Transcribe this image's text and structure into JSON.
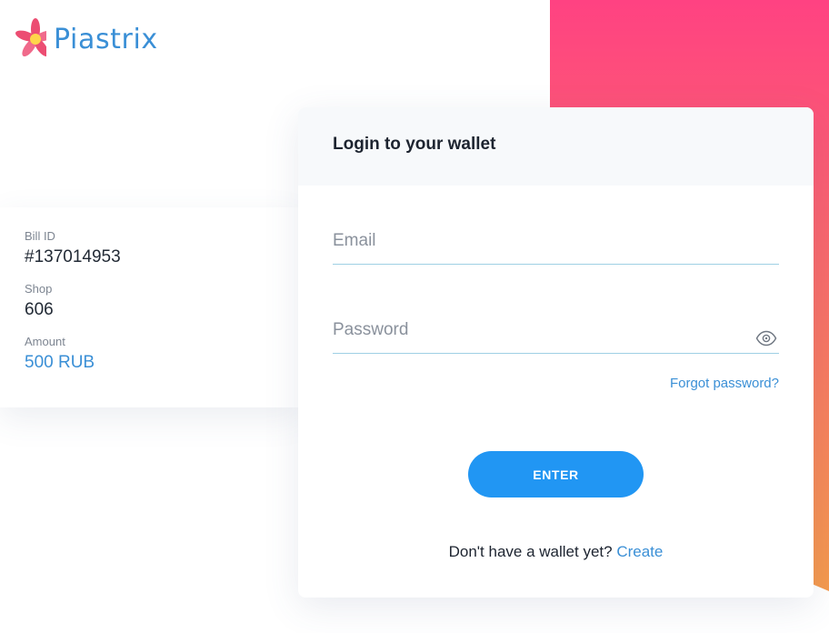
{
  "brand": {
    "name": "Piastrix"
  },
  "bill": {
    "bill_id_label": "Bill ID",
    "bill_id_value": "#137014953",
    "shop_label": "Shop",
    "shop_value": "606",
    "amount_label": "Amount",
    "amount_value": "500 RUB"
  },
  "login": {
    "title": "Login to your wallet",
    "email_placeholder": "Email",
    "password_placeholder": "Password",
    "forgot_label": "Forgot password?",
    "enter_label": "ENTER",
    "no_wallet_text": "Don't have a wallet yet?",
    "create_label": "Create"
  },
  "colors": {
    "accent": "#3a8fd6",
    "button": "#2196f3",
    "gradient_top": "#ff4282",
    "gradient_bottom": "#f59a4c"
  },
  "icons": {
    "logo": "flower-logo-icon",
    "password_toggle": "eye-icon"
  }
}
